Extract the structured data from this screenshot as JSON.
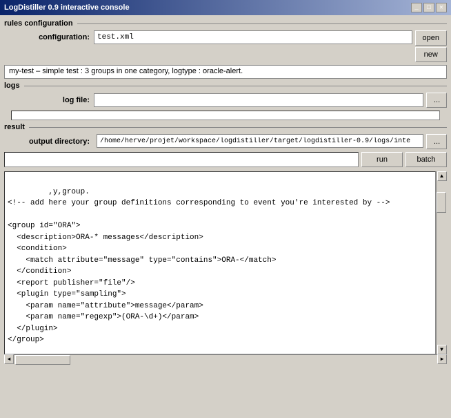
{
  "titleBar": {
    "title": "LogDistiller 0.9 interactive console",
    "minBtn": "_",
    "maxBtn": "□",
    "closeBtn": "✕"
  },
  "sections": {
    "rulesConfig": {
      "label": "rules configuration",
      "configLabel": "configuration:",
      "configValue": "test.xml",
      "openBtn": "open",
      "newBtn": "new"
    },
    "statusMsg": "my-test – simple test : 3 groups in one category, logtype : oracle-alert.",
    "logs": {
      "label": "logs",
      "logFileLabel": "log file:",
      "logFileValue": "",
      "browseBtn": "..."
    },
    "result": {
      "label": "result",
      "outputDirLabel": "output directory:",
      "outputDirValue": "/home/herve/projet/workspace/logdistiller/target/logdistiller-0.9/logs/inte",
      "browseBtn": "..."
    },
    "runBatch": {
      "runBtn": "run",
      "batchBtn": "batch"
    },
    "xmlContent": "   ,y,group.\n<!-- add here your group definitions corresponding to event you're interested by -->\n\n<group id=\"ORA\">\n  <description>ORA-* messages</description>\n  <condition>\n    <match attribute=\"message\" type=\"contains\">ORA-</match>\n  </condition>\n  <report publisher=\"file\"/>\n  <plugin type=\"sampling\">\n    <param name=\"attribute\">message</param>\n    <param name=\"regexp\">(ORA-\\d+)</param>\n  </plugin>\n</group>\n\n<group id=\"unknown\" save=\"false\">\n  <description>Unknown log events</description>\n  <publisher=\"file\"/> "
  }
}
